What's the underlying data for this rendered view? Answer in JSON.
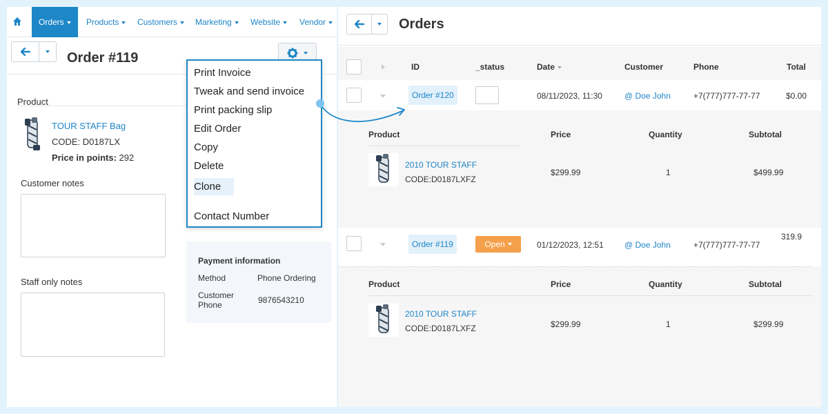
{
  "left": {
    "nav": [
      {
        "label": "Orders",
        "active": true
      },
      {
        "label": "Products"
      },
      {
        "label": "Customers"
      },
      {
        "label": "Marketing"
      },
      {
        "label": "Website"
      },
      {
        "label": "Vendor"
      }
    ],
    "order_title": "Order #119",
    "product_section": "Product",
    "product": {
      "name": "TOUR STAFF Bag",
      "code": "CODE: D0187LX",
      "points_label": "Price in points:",
      "points_value": "292"
    },
    "customer_notes_label": "Customer notes",
    "staff_notes_label": "Staff only notes",
    "payment": {
      "title": "Payment information",
      "method_label": "Method",
      "method_value": "Phone Ordering",
      "phone_label_1": "Customer",
      "phone_label_2": "Phone",
      "phone_value": "9876543210"
    }
  },
  "menu": {
    "items": [
      "Print Invoice",
      "Tweak and send invoice",
      "Print packing slip",
      "Edit Order",
      "Copy",
      "Delete",
      "Clone",
      "Contact Number"
    ]
  },
  "right": {
    "title": "Orders",
    "columns": [
      "ID",
      "_status",
      "Date",
      "Customer",
      "Phone",
      "Total"
    ],
    "detail_columns": [
      "Product",
      "Price",
      "Quantity",
      "Subtotal"
    ],
    "orders": [
      {
        "id": "Order #120",
        "status": "",
        "date": "08/11/2023, 11:30",
        "customer": "@ Doe John",
        "phone": "+7(777)777-77-77",
        "total": "$0.00",
        "item": {
          "name": "2010 TOUR STAFF",
          "code": "CODE:D0187LXFZ",
          "price": "$299.99",
          "qty": "1",
          "subtotal": "$499.99"
        }
      },
      {
        "id": "Order #119",
        "status": "Open",
        "date": "01/12/2023, 12:51",
        "customer": "@ Doe John",
        "phone": "+7(777)777-77-77",
        "total": "319.9",
        "item": {
          "name": "2010 TOUR STAFF",
          "code": "CODE:D0187LXFZ",
          "price": "$299.99",
          "qty": "1",
          "subtotal": "$299.99"
        }
      }
    ]
  },
  "colors": {
    "accent": "#1d87c8",
    "link": "#1e84c6",
    "open": "#f5a04a",
    "background": "#e3f3fd"
  },
  "icons": [
    "home-icon",
    "arrow-left-icon",
    "chevron-down-icon",
    "gear-icon",
    "golf-bag-icon",
    "sort-arrow-icon"
  ]
}
